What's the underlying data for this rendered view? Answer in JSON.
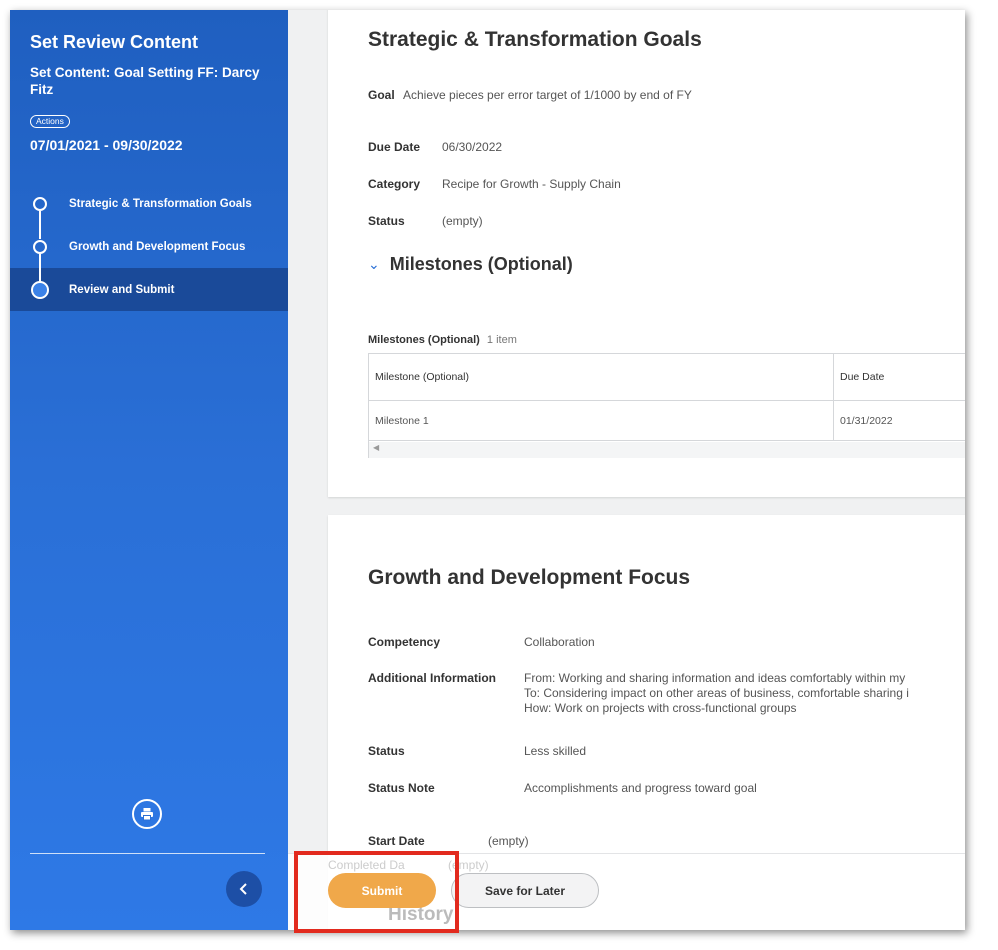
{
  "sidebar": {
    "title": "Set Review Content",
    "subtitle": "Set Content: Goal Setting FF: Darcy Fitz",
    "actions_label": "Actions",
    "date_range": "07/01/2021 - 09/30/2022",
    "steps": [
      {
        "label": "Strategic & Transformation Goals",
        "state": "completed"
      },
      {
        "label": "Growth and Development Focus",
        "state": "completed"
      },
      {
        "label": "Review and Submit",
        "state": "current"
      }
    ],
    "print_icon": "printer-icon",
    "collapse_icon": "chevron-left-icon"
  },
  "section1": {
    "title": "Strategic & Transformation Goals",
    "goal_label": "Goal",
    "goal_value": "Achieve pieces per error target of 1/1000 by end of FY",
    "due_label": "Due Date",
    "due_value": "06/30/2022",
    "category_label": "Category",
    "category_value": "Recipe for Growth - Supply Chain",
    "status_label": "Status",
    "status_value": "(empty)",
    "milestones_title": "Milestones (Optional)",
    "milestones_table": {
      "caption": "Milestones (Optional)",
      "count": "1 item",
      "columns": [
        "Milestone (Optional)",
        "Due Date"
      ],
      "rows": [
        [
          "Milestone 1",
          "01/31/2022"
        ]
      ]
    }
  },
  "section2": {
    "title": "Growth and Development Focus",
    "competency_label": "Competency",
    "competency_value": "Collaboration",
    "addinfo_label": "Additional Information",
    "addinfo_lines": [
      "From: Working and sharing information and ideas comfortably within my",
      "To: Considering impact on other areas of business, comfortable sharing i",
      "How: Work on projects with cross-functional groups"
    ],
    "status_label": "Status",
    "status_value": "Less skilled",
    "status_note_label": "Status Note",
    "status_note_value": "Accomplishments and progress toward goal",
    "start_label": "Start Date",
    "start_value": "(empty)",
    "completed_label": "Completed Da",
    "completed_value": "(empty)",
    "history_label": "History"
  },
  "footer": {
    "submit_label": "Submit",
    "save_later_label": "Save for Later"
  },
  "colors": {
    "sidebar_blue": "#2a6fd6",
    "active_step": "#1a4a99",
    "submit_orange": "#f0a84a",
    "highlight_red": "#e22a1e"
  }
}
